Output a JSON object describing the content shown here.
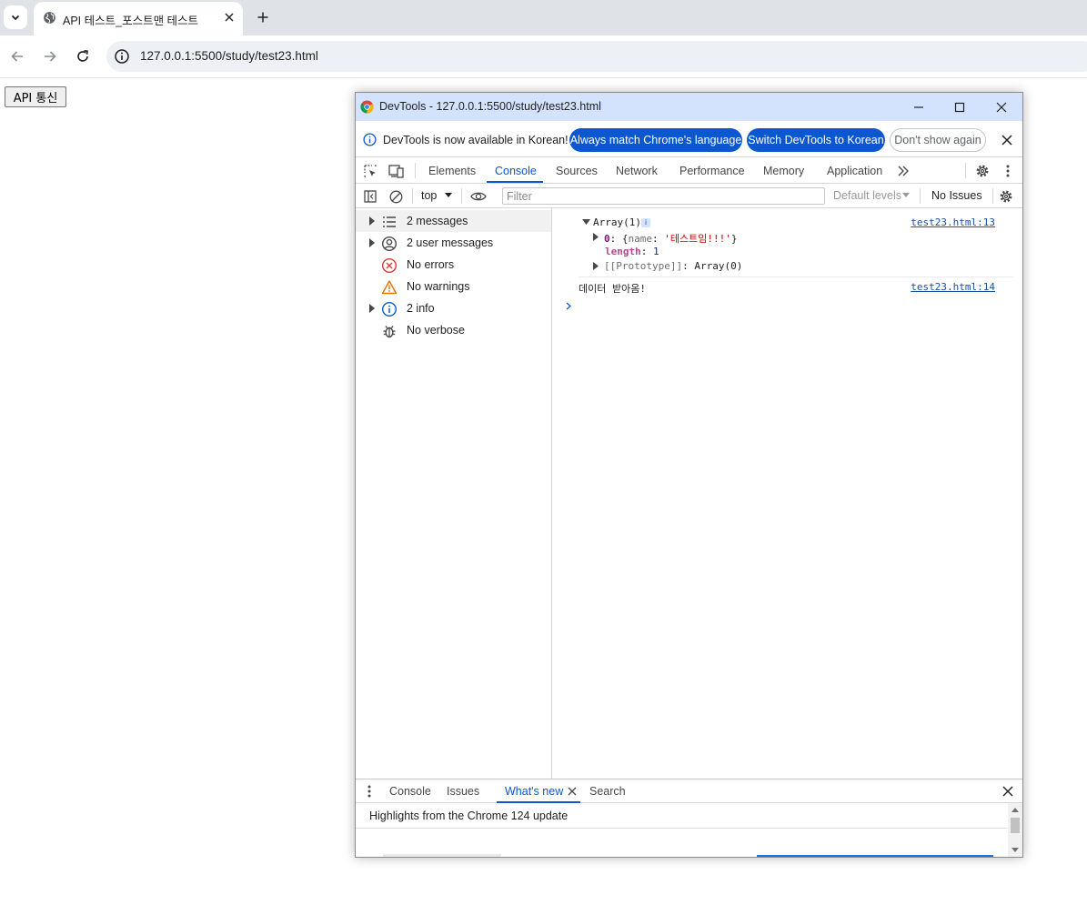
{
  "browser": {
    "tab": {
      "title": "API 테스트_포스트맨 테스트"
    },
    "omnibox": {
      "url": "127.0.0.1:5500/study/test23.html"
    }
  },
  "page": {
    "button_label": "API 통신"
  },
  "devtools": {
    "window_title": "DevTools - 127.0.0.1:5500/study/test23.html",
    "infobar": {
      "message": "DevTools is now available in Korean!",
      "always_match": "Always match Chrome's language",
      "switch": "Switch DevTools to Korean",
      "dont_show": "Don't show again"
    },
    "tabs": [
      {
        "label": "Elements"
      },
      {
        "label": "Console"
      },
      {
        "label": "Sources"
      },
      {
        "label": "Network"
      },
      {
        "label": "Performance"
      },
      {
        "label": "Memory"
      },
      {
        "label": "Application"
      }
    ],
    "console_toolbar": {
      "context": "top",
      "filter_placeholder": "Filter",
      "levels": "Default levels",
      "issues": "No Issues"
    },
    "sidebar": {
      "items": [
        {
          "label": "2 messages"
        },
        {
          "label": "2 user messages"
        },
        {
          "label": "No errors"
        },
        {
          "label": "No warnings"
        },
        {
          "label": "2 info"
        },
        {
          "label": "No verbose"
        }
      ]
    },
    "console": {
      "log1": {
        "summary": "Array(1)",
        "source": "test23.html:13",
        "item0_index": "0",
        "item0_open": "{",
        "item0_key": "name",
        "item0_value": "'테스트임!!!'",
        "item0_close": "}",
        "length_key": "length",
        "length_value": "1",
        "proto_key": "[[Prototype]]",
        "proto_value": "Array(0)"
      },
      "log2": {
        "text": "데이터 받아옴!",
        "source": "test23.html:14"
      }
    },
    "drawer": {
      "tabs": [
        {
          "label": "Console"
        },
        {
          "label": "Issues"
        },
        {
          "label": "What's new"
        },
        {
          "label": "Search"
        }
      ],
      "whats_new_heading": "Highlights from the Chrome 124 update"
    }
  }
}
